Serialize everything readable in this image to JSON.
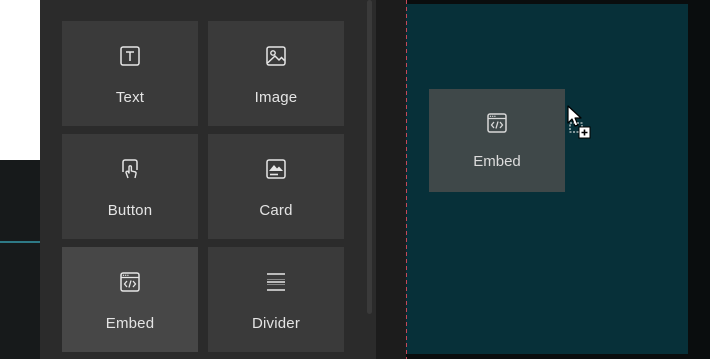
{
  "panel": {
    "tiles": [
      {
        "label": "Text",
        "icon": "text-icon"
      },
      {
        "label": "Image",
        "icon": "image-icon"
      },
      {
        "label": "Button",
        "icon": "button-icon"
      },
      {
        "label": "Card",
        "icon": "card-icon"
      },
      {
        "label": "Embed",
        "icon": "embed-icon"
      },
      {
        "label": "Divider",
        "icon": "divider-icon"
      }
    ]
  },
  "canvas": {
    "drag_preview": {
      "label": "Embed",
      "icon": "embed-icon"
    },
    "cursor": "drag-copy-cursor"
  },
  "colors": {
    "panel_bg": "#2b2b2b",
    "tile_bg": "#3a3a3a",
    "canvas_bg": "#073039",
    "guide_line": "#c4495a"
  }
}
